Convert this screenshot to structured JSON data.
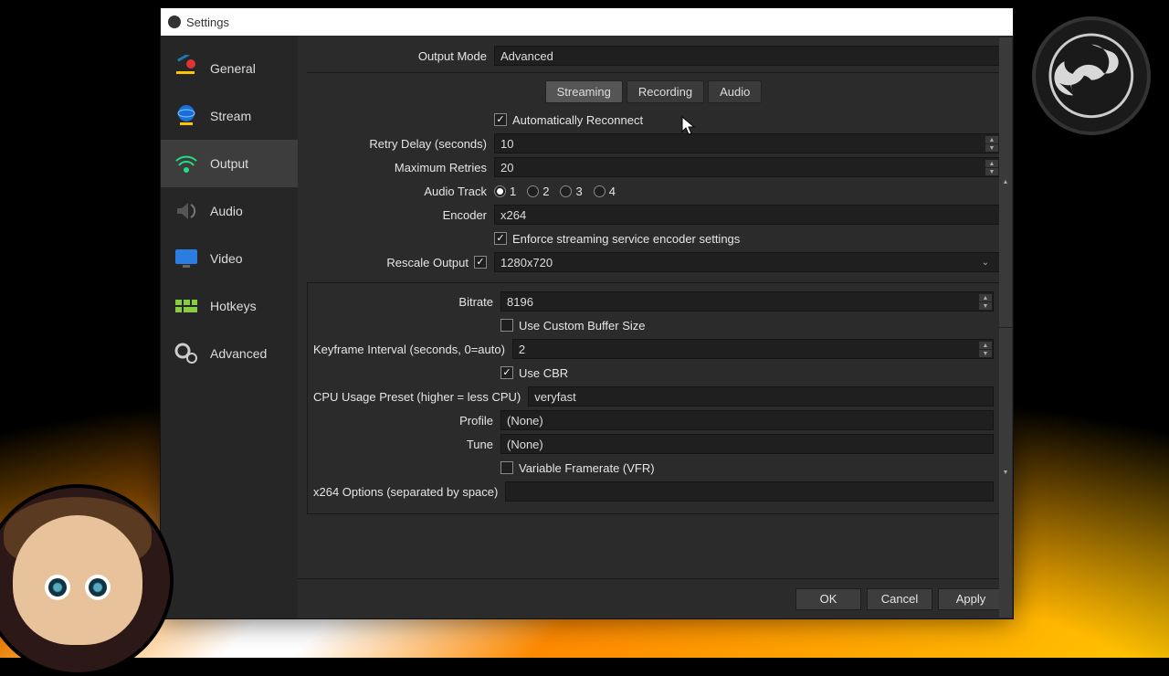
{
  "window": {
    "title": "Settings"
  },
  "sidebar": {
    "items": [
      {
        "label": "General"
      },
      {
        "label": "Stream"
      },
      {
        "label": "Output"
      },
      {
        "label": "Audio"
      },
      {
        "label": "Video"
      },
      {
        "label": "Hotkeys"
      },
      {
        "label": "Advanced"
      }
    ],
    "active_index": 2
  },
  "output_mode": {
    "label": "Output Mode",
    "value": "Advanced"
  },
  "tabs": {
    "items": [
      "Streaming",
      "Recording",
      "Audio"
    ],
    "active_index": 0
  },
  "streaming": {
    "auto_reconnect": {
      "label": "Automatically Reconnect",
      "checked": true
    },
    "retry_delay": {
      "label": "Retry Delay (seconds)",
      "value": "10"
    },
    "max_retries": {
      "label": "Maximum Retries",
      "value": "20"
    },
    "audio_track": {
      "label": "Audio Track",
      "options": [
        "1",
        "2",
        "3",
        "4"
      ],
      "selected_index": 0
    },
    "encoder": {
      "label": "Encoder",
      "value": "x264"
    },
    "enforce": {
      "label": "Enforce streaming service encoder settings",
      "checked": true
    },
    "rescale": {
      "label": "Rescale Output",
      "checked": true,
      "value": "1280x720"
    },
    "bitrate": {
      "label": "Bitrate",
      "value": "8196"
    },
    "custom_buffer": {
      "label": "Use Custom Buffer Size",
      "checked": false
    },
    "keyframe": {
      "label": "Keyframe Interval (seconds, 0=auto)",
      "value": "2"
    },
    "use_cbr": {
      "label": "Use CBR",
      "checked": true
    },
    "cpu_preset": {
      "label": "CPU Usage Preset (higher = less CPU)",
      "value": "veryfast"
    },
    "profile": {
      "label": "Profile",
      "value": "(None)"
    },
    "tune": {
      "label": "Tune",
      "value": "(None)"
    },
    "vfr": {
      "label": "Variable Framerate (VFR)",
      "checked": false
    },
    "x264_opts": {
      "label": "x264 Options (separated by space)",
      "value": ""
    }
  },
  "footer": {
    "ok": "OK",
    "cancel": "Cancel",
    "apply": "Apply"
  }
}
